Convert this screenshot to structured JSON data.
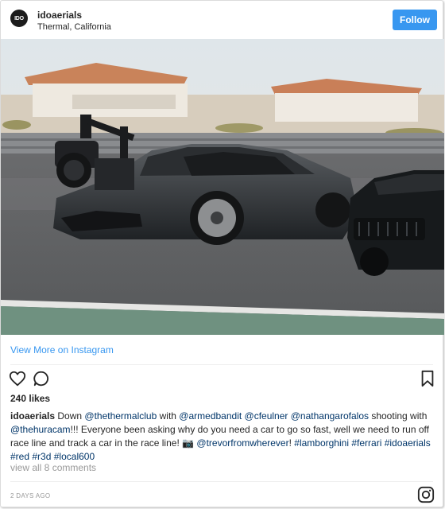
{
  "post": {
    "username": "idoaerials",
    "location": "Thermal, California",
    "follow_label": "Follow",
    "avatar_text": "IDO"
  },
  "view_more_label": "View More on Instagram",
  "likes": "240 likes",
  "caption": {
    "username": "idoaerials",
    "segments": [
      {
        "t": " Down ",
        "link": false
      },
      {
        "t": "@thethermalclub",
        "link": true
      },
      {
        "t": " with ",
        "link": false
      },
      {
        "t": "@armedbandit",
        "link": true
      },
      {
        "t": " ",
        "link": false
      },
      {
        "t": "@cfeulner",
        "link": true
      },
      {
        "t": " ",
        "link": false
      },
      {
        "t": "@nathangarofalos",
        "link": true
      },
      {
        "t": " shooting with ",
        "link": false
      },
      {
        "t": "@thehuracam",
        "link": true
      },
      {
        "t": "!!! Everyone been asking why do you need a car to go so fast, well we need to run off race line and track a car in the race line! 📷 ",
        "link": false
      },
      {
        "t": "@trevorfromwherever",
        "link": true
      },
      {
        "t": "! ",
        "link": false
      },
      {
        "t": "#lamborghini",
        "link": true
      },
      {
        "t": " ",
        "link": false
      },
      {
        "t": "#ferrari",
        "link": true
      },
      {
        "t": " ",
        "link": false
      },
      {
        "t": "#idoaerials",
        "link": true
      },
      {
        "t": " ",
        "link": false
      },
      {
        "t": "#red",
        "link": true
      },
      {
        "t": " ",
        "link": false
      },
      {
        "t": "#r3d",
        "link": true
      },
      {
        "t": " ",
        "link": false
      },
      {
        "t": "#local600",
        "link": true
      }
    ]
  },
  "comments_label": "view all 8 comments",
  "date": "2 DAYS AGO",
  "icons": {
    "like": "heart-icon",
    "comment": "comment-icon",
    "save": "bookmark-icon",
    "brand": "instagram-icon"
  },
  "colors": {
    "follow_button": "#3897f0",
    "link_blue": "#3897f0",
    "hashtag": "#003569",
    "muted": "#999999"
  }
}
